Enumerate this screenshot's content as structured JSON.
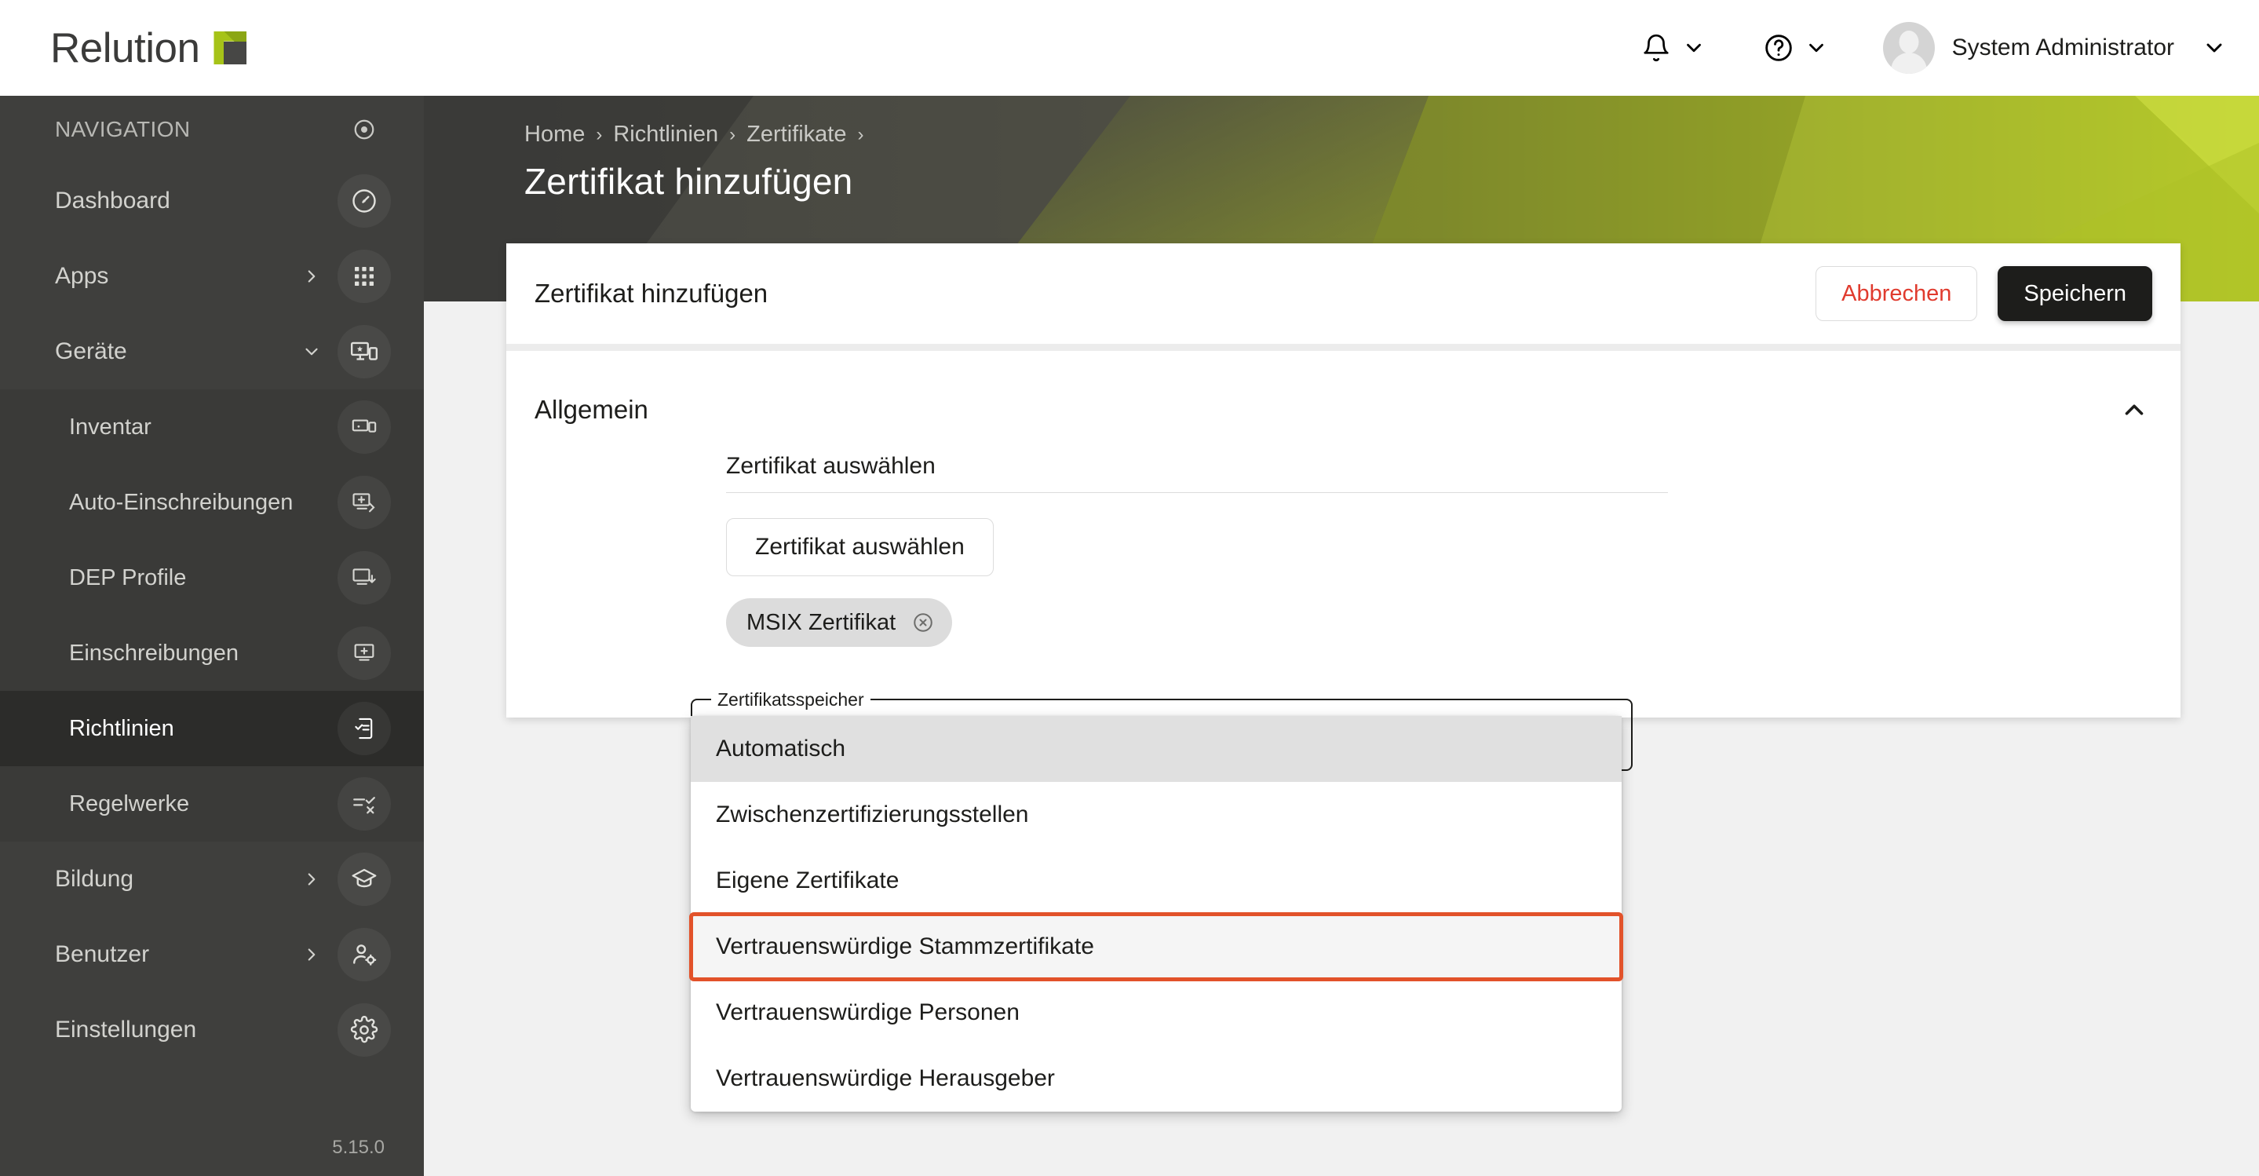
{
  "brand": {
    "name": "Relution",
    "logo_icon": "relution-logo-icon"
  },
  "topbar": {
    "notifications_icon": "bell-icon",
    "help_icon": "question-circle-icon",
    "chevron_icon": "chevron-down-icon",
    "avatar_icon": "user-avatar-icon",
    "username": "System Administrator"
  },
  "sidebar": {
    "header_label": "NAVIGATION",
    "header_icon": "target-dot-icon",
    "version": "5.15.0",
    "items": [
      {
        "label": "Dashboard",
        "icon": "speedometer-icon",
        "arrow": "",
        "active": false
      },
      {
        "label": "Apps",
        "icon": "grid-apps-icon",
        "arrow": "chevron-right-icon",
        "active": false
      },
      {
        "label": "Geräte",
        "icon": "devices-star-icon",
        "arrow": "chevron-down-icon",
        "active": false
      }
    ],
    "sub_items": [
      {
        "label": "Inventar",
        "icon": "devices-inventory-icon",
        "active": false
      },
      {
        "label": "Auto-Einschreibungen",
        "icon": "auto-enroll-icon",
        "active": false
      },
      {
        "label": "DEP Profile",
        "icon": "monitor-download-icon",
        "active": false
      },
      {
        "label": "Einschreibungen",
        "icon": "monitor-plus-icon",
        "active": false
      },
      {
        "label": "Richtlinien",
        "icon": "policy-check-icon",
        "active": true
      },
      {
        "label": "Regelwerke",
        "icon": "rules-check-x-icon",
        "active": false
      }
    ],
    "bottom_items": [
      {
        "label": "Bildung",
        "icon": "graduation-cap-icon",
        "arrow": "chevron-right-icon",
        "active": false
      },
      {
        "label": "Benutzer",
        "icon": "user-gear-icon",
        "arrow": "chevron-right-icon",
        "active": false
      },
      {
        "label": "Einstellungen",
        "icon": "gear-icon",
        "arrow": "",
        "active": false
      }
    ]
  },
  "header": {
    "breadcrumb": [
      "Home",
      "Richtlinien",
      "Zertifikate"
    ],
    "breadcrumb_separator": "›",
    "page_title": "Zertifikat hinzufügen"
  },
  "card": {
    "title": "Zertifikat hinzufügen",
    "cancel_label": "Abbrechen",
    "save_label": "Speichern"
  },
  "section": {
    "title": "Allgemein",
    "collapse_icon": "chevron-up-icon"
  },
  "form": {
    "picker_label": "Zertifikat auswählen",
    "select_button_label": "Zertifikat auswählen",
    "chip_label": "MSIX Zertifikat",
    "chip_remove_icon": "close-circle-icon"
  },
  "select": {
    "legend": "Zertifikatsspeicher",
    "options": [
      {
        "label": "Automatisch",
        "state": "selected"
      },
      {
        "label": "Zwischenzertifizierungsstellen",
        "state": "normal"
      },
      {
        "label": "Eigene Zertifikate",
        "state": "normal"
      },
      {
        "label": "Vertrauenswürdige Stammzertifikate",
        "state": "highlighted"
      },
      {
        "label": "Vertrauenswürdige Personen",
        "state": "normal"
      },
      {
        "label": "Vertrauenswürdige Herausgeber",
        "state": "normal"
      }
    ]
  },
  "colors": {
    "brand_green": "#a6c318",
    "sidebar_bg": "#3f3f3d",
    "highlight_orange": "#e2522a",
    "cancel_red": "#e03b2e",
    "save_black": "#1d1d1b"
  }
}
